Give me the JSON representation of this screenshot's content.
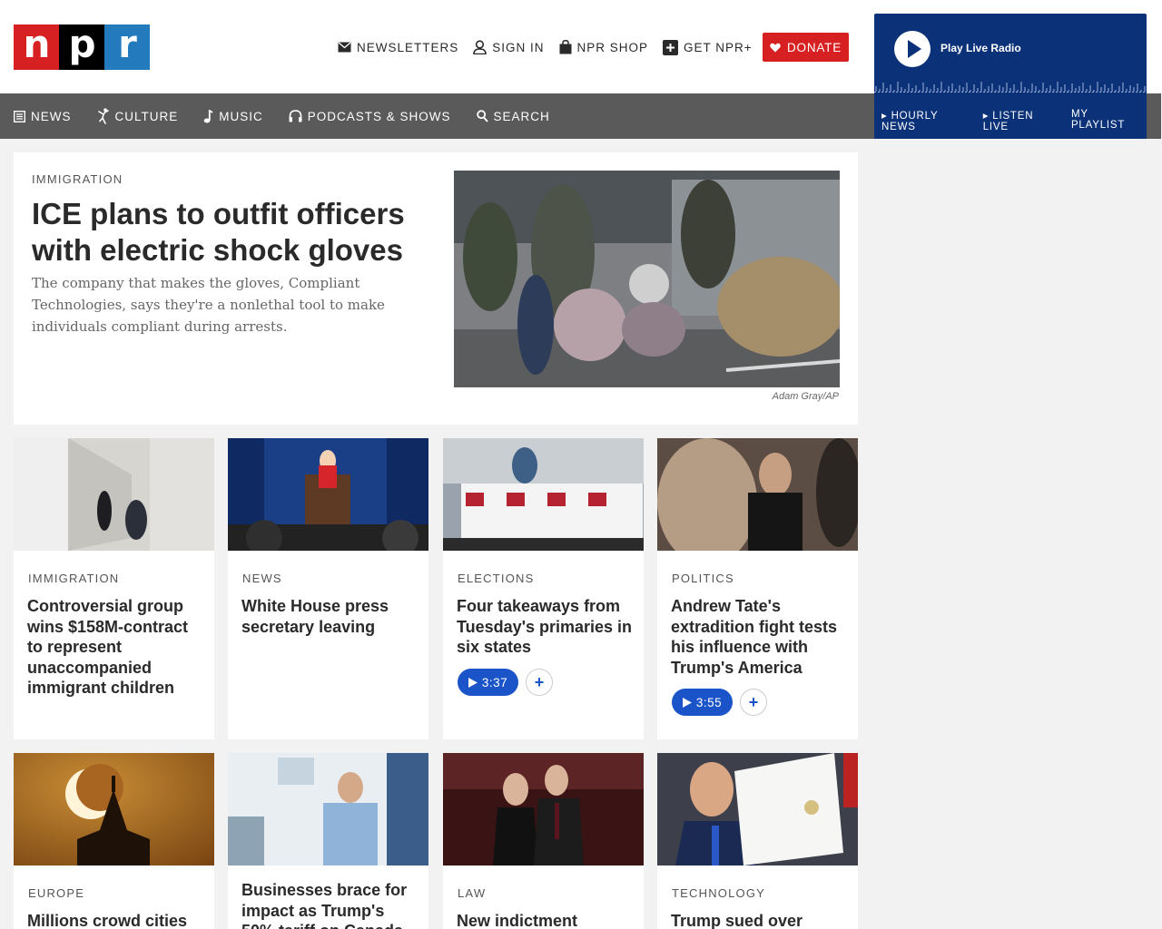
{
  "logo": {
    "letters": [
      "n",
      "p",
      "r"
    ]
  },
  "utility_nav": [
    {
      "label": "NEWSLETTERS",
      "icon": "envelope-icon"
    },
    {
      "label": "SIGN IN",
      "icon": "user-icon"
    },
    {
      "label": "NPR SHOP",
      "icon": "shopping-bag-icon"
    },
    {
      "label": "GET NPR+",
      "icon": "plus-box-icon"
    }
  ],
  "donate": {
    "label": "DONATE",
    "icon": "heart-icon"
  },
  "player": {
    "play_label": "Play Live Radio",
    "links": [
      "HOURLY NEWS",
      "LISTEN LIVE",
      "MY PLAYLIST"
    ]
  },
  "main_nav": [
    {
      "label": "NEWS",
      "icon": "newspaper-icon"
    },
    {
      "label": "CULTURE",
      "icon": "dancer-icon"
    },
    {
      "label": "MUSIC",
      "icon": "music-note-icon"
    },
    {
      "label": "PODCASTS & SHOWS",
      "icon": "headphones-icon"
    },
    {
      "label": "SEARCH",
      "icon": "search-icon"
    }
  ],
  "hero": {
    "kicker": "IMMIGRATION",
    "title": "ICE plans to outfit officers with electric shock gloves",
    "teaser": "The company that makes the gloves, Compliant Technologies, says they're a nonlethal tool to make individuals compliant during arrests.",
    "credit": "Adam Gray/AP"
  },
  "stories": [
    {
      "kicker": "IMMIGRATION",
      "title": "Controversial group wins $158M-contract to represent unaccompanied immigrant children"
    },
    {
      "kicker": "NEWS",
      "title": "White House press secretary leaving"
    },
    {
      "kicker": "ELECTIONS",
      "title": "Four takeaways from Tuesday's primaries in six states",
      "audio": "3:37"
    },
    {
      "kicker": "POLITICS",
      "title": "Andrew Tate's extradition fight tests his influence with Trump's America",
      "audio": "3:55"
    },
    {
      "kicker": "EUROPE",
      "title": "Millions crowd cities"
    },
    {
      "kicker": "",
      "title": "Businesses brace for impact as Trump's 50% tariff on Canada"
    },
    {
      "kicker": "LAW",
      "title": "New indictment"
    },
    {
      "kicker": "TECHNOLOGY",
      "title": "Trump sued over"
    }
  ],
  "audio_add_label": "+",
  "colors": {
    "npr_red": "#d62021",
    "npr_blue": "#237bbd",
    "player_navy": "#0b3179",
    "nav_gray": "#5a5a5a",
    "audio_blue": "#1a54c8"
  }
}
